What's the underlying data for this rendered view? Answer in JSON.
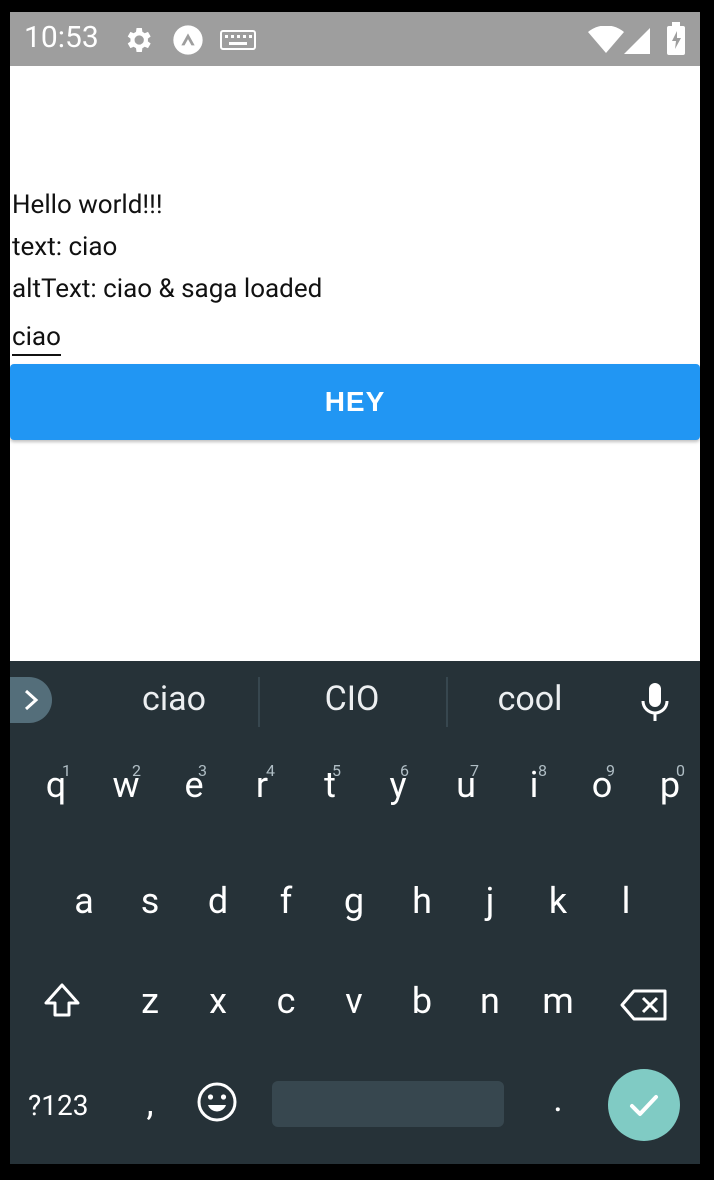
{
  "status_bar": {
    "time": "10:53"
  },
  "app": {
    "hello": "Hello world!!!",
    "text_line": "text: ciao",
    "alt_text_line": "altText: ciao & saga loaded",
    "input_value": "ciao",
    "button_label": "HEY"
  },
  "keyboard": {
    "suggestions": [
      "ciao",
      "CIO",
      "cool"
    ],
    "row1": [
      "q",
      "w",
      "e",
      "r",
      "t",
      "y",
      "u",
      "i",
      "o",
      "p"
    ],
    "row1_hints": [
      "1",
      "2",
      "3",
      "4",
      "5",
      "6",
      "7",
      "8",
      "9",
      "0"
    ],
    "row2": [
      "a",
      "s",
      "d",
      "f",
      "g",
      "h",
      "j",
      "k",
      "l"
    ],
    "row3": [
      "z",
      "x",
      "c",
      "v",
      "b",
      "n",
      "m"
    ],
    "symbols_key": "?123",
    "comma_key": ",",
    "period_key": "."
  },
  "colors": {
    "accent": "#2196f3",
    "enter": "#80cbc4",
    "keyboard_bg": "#263238"
  }
}
